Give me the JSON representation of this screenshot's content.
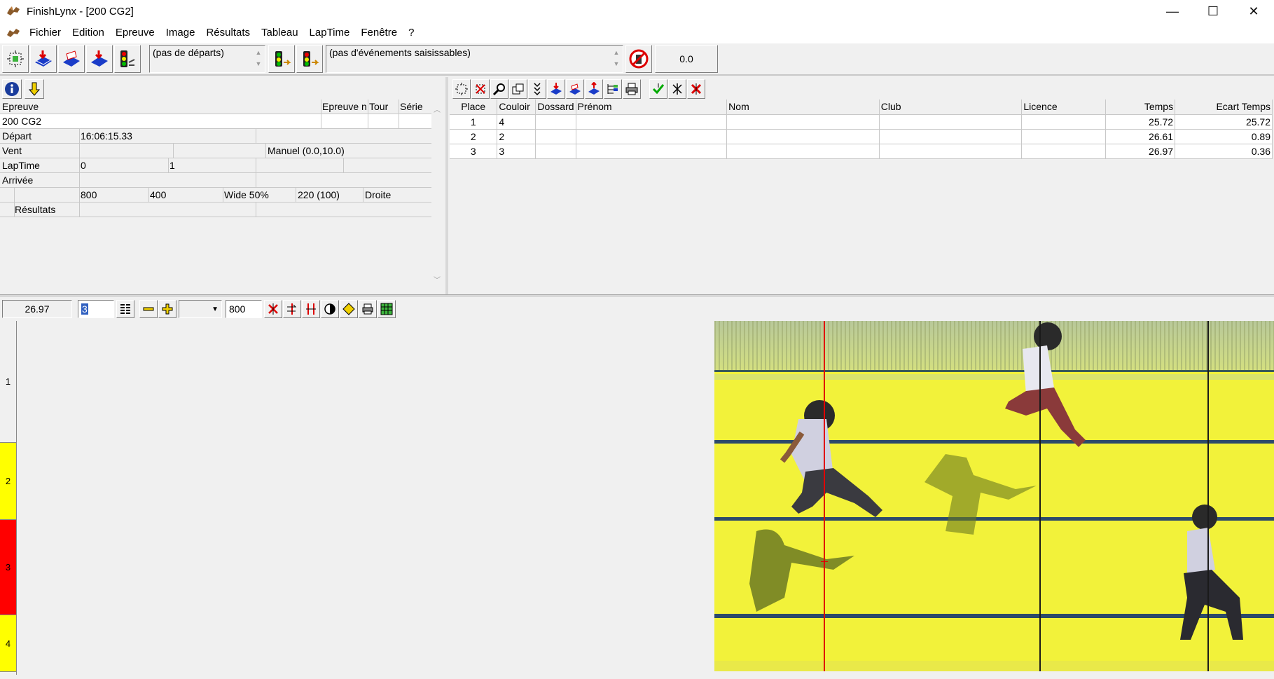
{
  "window": {
    "title": "FinishLynx - [200 CG2]",
    "minimize": "—",
    "maximize": "☐",
    "close": "✕"
  },
  "menu": [
    "Fichier",
    "Edition",
    "Epreuve",
    "Image",
    "Résultats",
    "Tableau",
    "LapTime",
    "Fenêtre",
    "?"
  ],
  "toolbar": {
    "starts_list": "(pas de départs)",
    "events_list": "(pas d'événements saisissables)",
    "wind_value": "0.0"
  },
  "event_info": {
    "header": {
      "epreuve": "Epreuve",
      "epreuve_n": "Epreuve n",
      "tour": "Tour",
      "serie": "Série"
    },
    "event_name": "200 CG2",
    "depart_label": "Départ",
    "depart_time": "16:06:15.33",
    "vent_label": "Vent",
    "vent_value": "Manuel (0.0,10.0)",
    "laptime_label": "LapTime",
    "laptime_a": "0",
    "laptime_b": "1",
    "arrivee_label": "Arrivée",
    "cfg_1": "800",
    "cfg_2": "400",
    "cfg_3": "Wide 50%",
    "cfg_4": "220  (100)",
    "cfg_5": "Droite",
    "resultats_label": "Résultats"
  },
  "results": {
    "columns": [
      "Place",
      "Couloir",
      "Dossard",
      "Prénom",
      "Nom",
      "Club",
      "Licence",
      "Temps",
      "Ecart Temps"
    ],
    "rows": [
      {
        "place": "1",
        "couloir": "4",
        "dossard": "",
        "prenom": "",
        "nom": "",
        "club": "",
        "licence": "",
        "temps": "25.72",
        "ecart": "25.72"
      },
      {
        "place": "2",
        "couloir": "2",
        "dossard": "",
        "prenom": "",
        "nom": "",
        "club": "",
        "licence": "",
        "temps": "26.61",
        "ecart": "0.89"
      },
      {
        "place": "3",
        "couloir": "3",
        "dossard": "",
        "prenom": "",
        "nom": "",
        "club": "",
        "licence": "",
        "temps": "26.97",
        "ecart": "0.36"
      }
    ]
  },
  "image_toolbar": {
    "time_readout": "26.97",
    "lane_input": "3",
    "zoom_value": "800"
  },
  "lanes": [
    "1",
    "2",
    "3",
    "4"
  ],
  "colors": {
    "lane_yellow": "#ffff00",
    "lane_red": "#ff0000",
    "photo_yellow": "#f2f23a",
    "cursor_red": "#e00000"
  }
}
